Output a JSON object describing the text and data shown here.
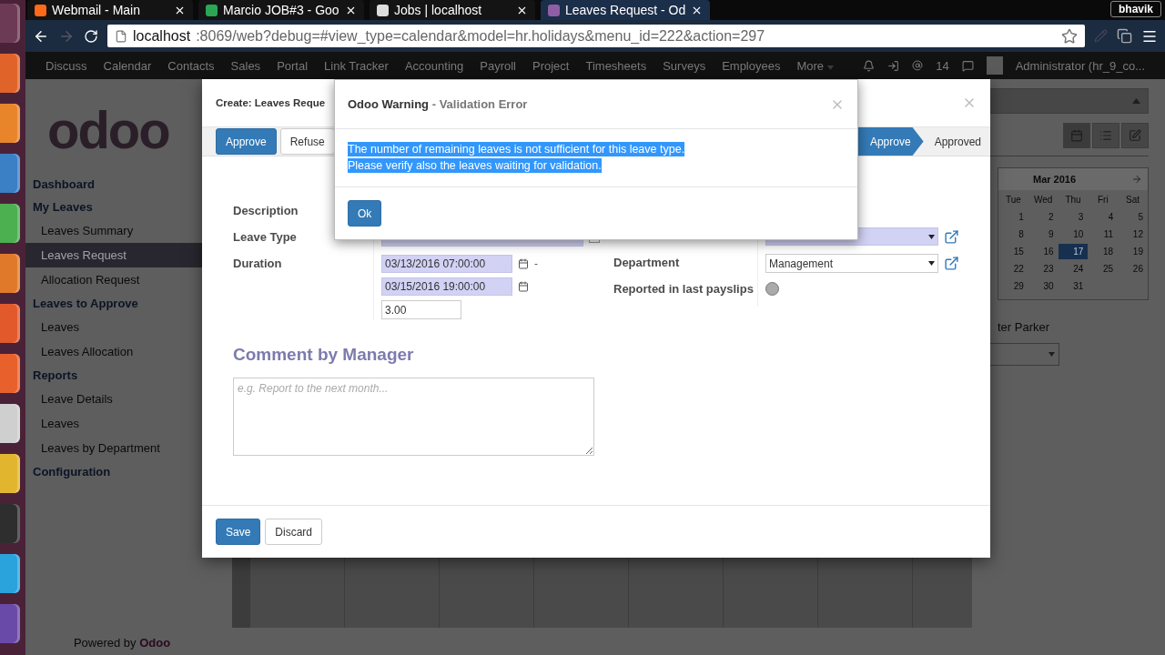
{
  "browser": {
    "tabs": [
      {
        "title": "Webmail - Main",
        "selected": false
      },
      {
        "title": "Marcio JOB#3 - Goo",
        "selected": false
      },
      {
        "title": "Jobs | localhost",
        "selected": false
      },
      {
        "title": "Leaves Request - Od",
        "selected": true
      }
    ],
    "user": "bhavik",
    "url_host": "localhost",
    "url_rest": ":8069/web?debug=#view_type=calendar&model=hr.holidays&menu_id=222&action=297"
  },
  "top_menu": {
    "items": [
      "Discuss",
      "Calendar",
      "Contacts",
      "Sales",
      "Portal",
      "Link Tracker",
      "Accounting",
      "Payroll",
      "Project",
      "Timesheets",
      "Surveys",
      "Employees"
    ],
    "more": "More",
    "notifications": "14",
    "user": "Administrator (hr_9_co..."
  },
  "sidebar": {
    "logo": "odoo",
    "sections": [
      {
        "title": "Dashboard"
      },
      {
        "title": "My Leaves",
        "items": [
          {
            "label": "Leaves Summary",
            "selected": false
          },
          {
            "label": "Leaves Request",
            "selected": true
          },
          {
            "label": "Allocation Request",
            "selected": false
          }
        ]
      },
      {
        "title": "Leaves to Approve",
        "items": [
          {
            "label": "Leaves",
            "selected": false
          },
          {
            "label": "Leaves Allocation",
            "selected": false
          }
        ]
      },
      {
        "title": "Reports",
        "items": [
          {
            "label": "Leave Details",
            "selected": false
          },
          {
            "label": "Leaves",
            "selected": false
          },
          {
            "label": "Leaves by Department",
            "selected": false
          }
        ]
      },
      {
        "title": "Configuration"
      }
    ],
    "footer_prefix": "Powered by",
    "footer_brand": "Odoo"
  },
  "calendar_panel": {
    "month": "Mar 2016",
    "weekdays": [
      "Tue",
      "Wed",
      "Thu",
      "Fri",
      "Sat"
    ],
    "weeks": [
      [
        {
          "day": "1",
          "selected": false
        },
        {
          "day": "2",
          "selected": false
        },
        {
          "day": "3",
          "selected": false
        },
        {
          "day": "4",
          "selected": false
        },
        {
          "day": "5",
          "selected": false
        }
      ],
      [
        {
          "day": "8",
          "selected": false
        },
        {
          "day": "9",
          "selected": false
        },
        {
          "day": "10",
          "selected": false
        },
        {
          "day": "11",
          "selected": false
        },
        {
          "day": "12",
          "selected": false
        }
      ],
      [
        {
          "day": "15",
          "selected": false
        },
        {
          "day": "16",
          "selected": false
        },
        {
          "day": "17",
          "selected": true
        },
        {
          "day": "18",
          "selected": false
        },
        {
          "day": "19",
          "selected": false
        }
      ],
      [
        {
          "day": "22",
          "selected": false
        },
        {
          "day": "23",
          "selected": false
        },
        {
          "day": "24",
          "selected": false
        },
        {
          "day": "25",
          "selected": false
        },
        {
          "day": "26",
          "selected": false
        }
      ],
      [
        {
          "day": "29",
          "selected": false
        },
        {
          "day": "30",
          "selected": false
        },
        {
          "day": "31",
          "selected": false
        }
      ]
    ],
    "attendee": "ter Parker"
  },
  "form_dialog": {
    "title": "Create: Leaves Reque",
    "header_buttons": [
      {
        "label": "Approve",
        "kind": "primary"
      },
      {
        "label": "Refuse",
        "kind": "default"
      }
    ],
    "stages": [
      {
        "label": "Approve",
        "selected": true
      },
      {
        "label": "Approved",
        "selected": false
      }
    ],
    "description": {
      "label": "Description"
    },
    "leave_type": {
      "label": "Leave Type"
    },
    "duration": {
      "label": "Duration",
      "from": "03/13/2016 07:00:00",
      "separator": "-",
      "to": "03/15/2016 19:00:00",
      "days": "3.00"
    },
    "department": {
      "label": "Department",
      "value": "Management"
    },
    "reported": {
      "label": "Reported in last payslips",
      "checked": false
    },
    "comment": {
      "title": "Comment by Manager",
      "placeholder": "e.g. Report to the next month..."
    },
    "footer_buttons": [
      {
        "label": "Save",
        "kind": "primary"
      },
      {
        "label": "Discard",
        "kind": "default"
      }
    ]
  },
  "warning_dialog": {
    "title": "Odoo Warning",
    "subtitle": "- Validation Error",
    "text_selected": true,
    "lines": [
      "The number of remaining leaves is not sufficient for this leave type.",
      "Please verify also the leaves waiting for validation."
    ],
    "button": "Ok"
  }
}
